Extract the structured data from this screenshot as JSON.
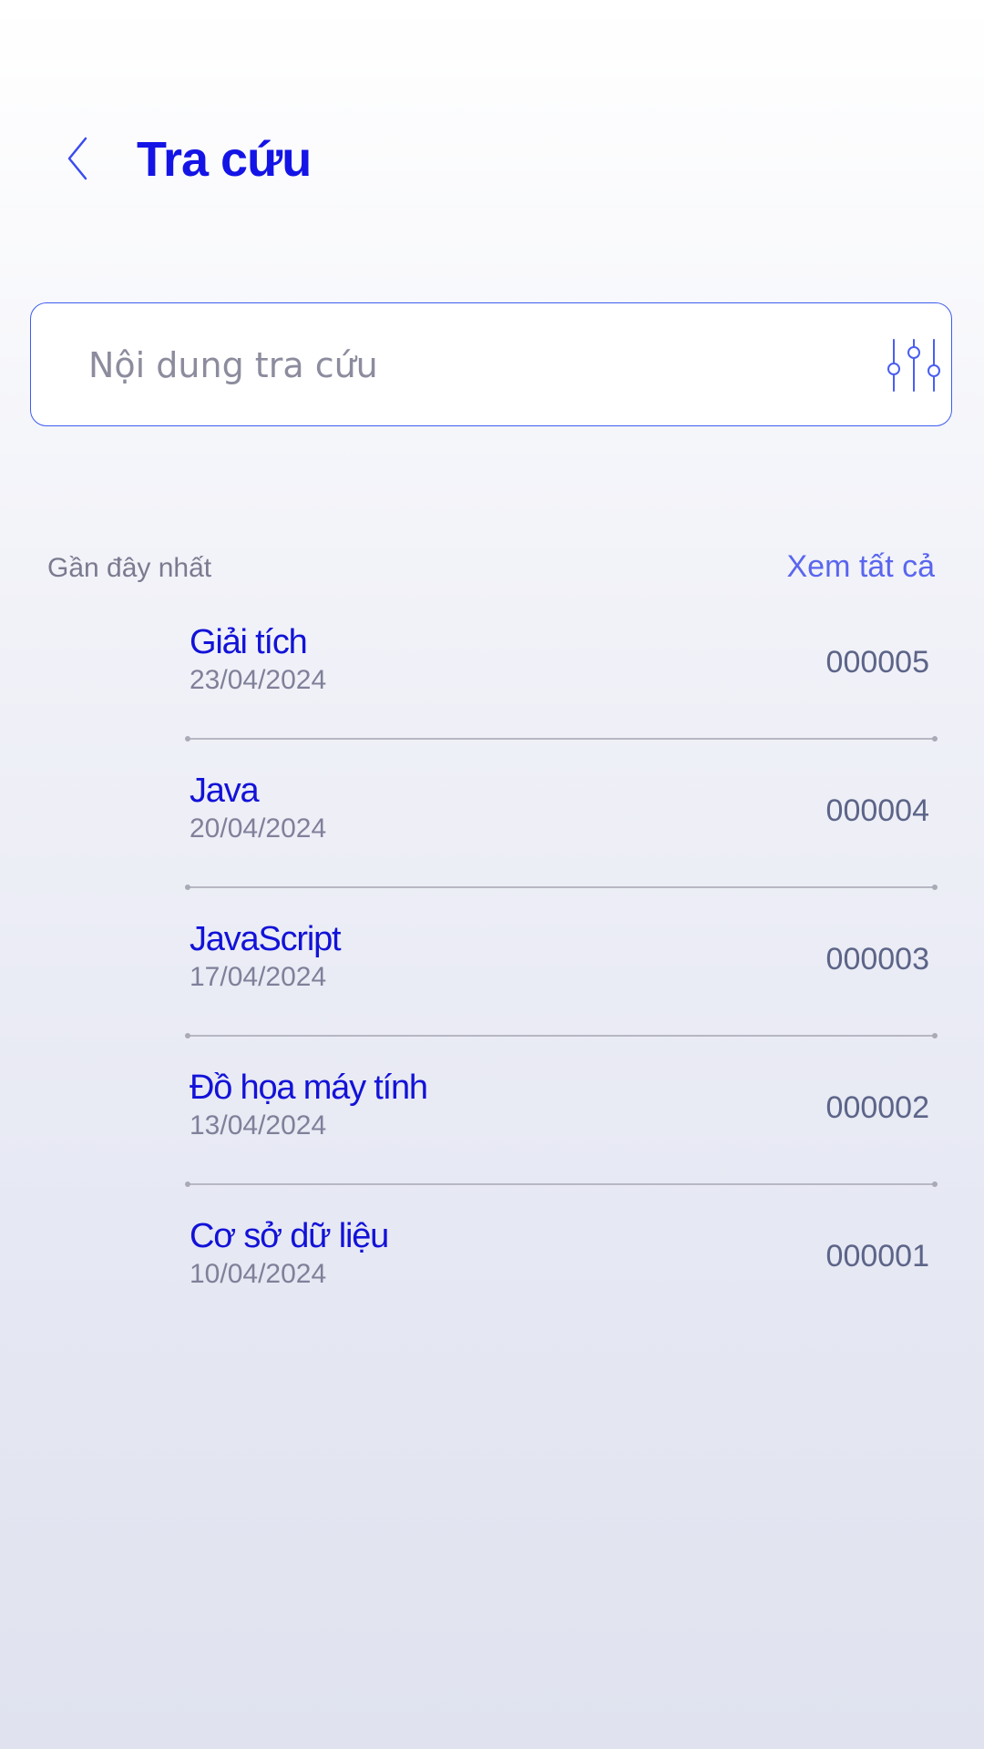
{
  "header": {
    "title": "Tra cứu",
    "back_icon": "chevron-left-icon"
  },
  "search": {
    "placeholder": "Nội dung tra cứu",
    "value": "",
    "filter_icon": "sliders-icon"
  },
  "recent": {
    "label": "Gần đây nhất",
    "see_all": "Xem tất cả",
    "items": [
      {
        "title": "Giải tích",
        "date": "23/04/2024",
        "code": "000005"
      },
      {
        "title": "Java",
        "date": "20/04/2024",
        "code": "000004"
      },
      {
        "title": "JavaScript",
        "date": "17/04/2024",
        "code": "000003"
      },
      {
        "title": "Đồ họa máy tính",
        "date": "13/04/2024",
        "code": "000002"
      },
      {
        "title": "Cơ sở dữ liệu",
        "date": "10/04/2024",
        "code": "000001"
      }
    ]
  },
  "colors": {
    "accent": "#1414e6",
    "link": "#5a66ee",
    "border": "#3d5cf0"
  }
}
